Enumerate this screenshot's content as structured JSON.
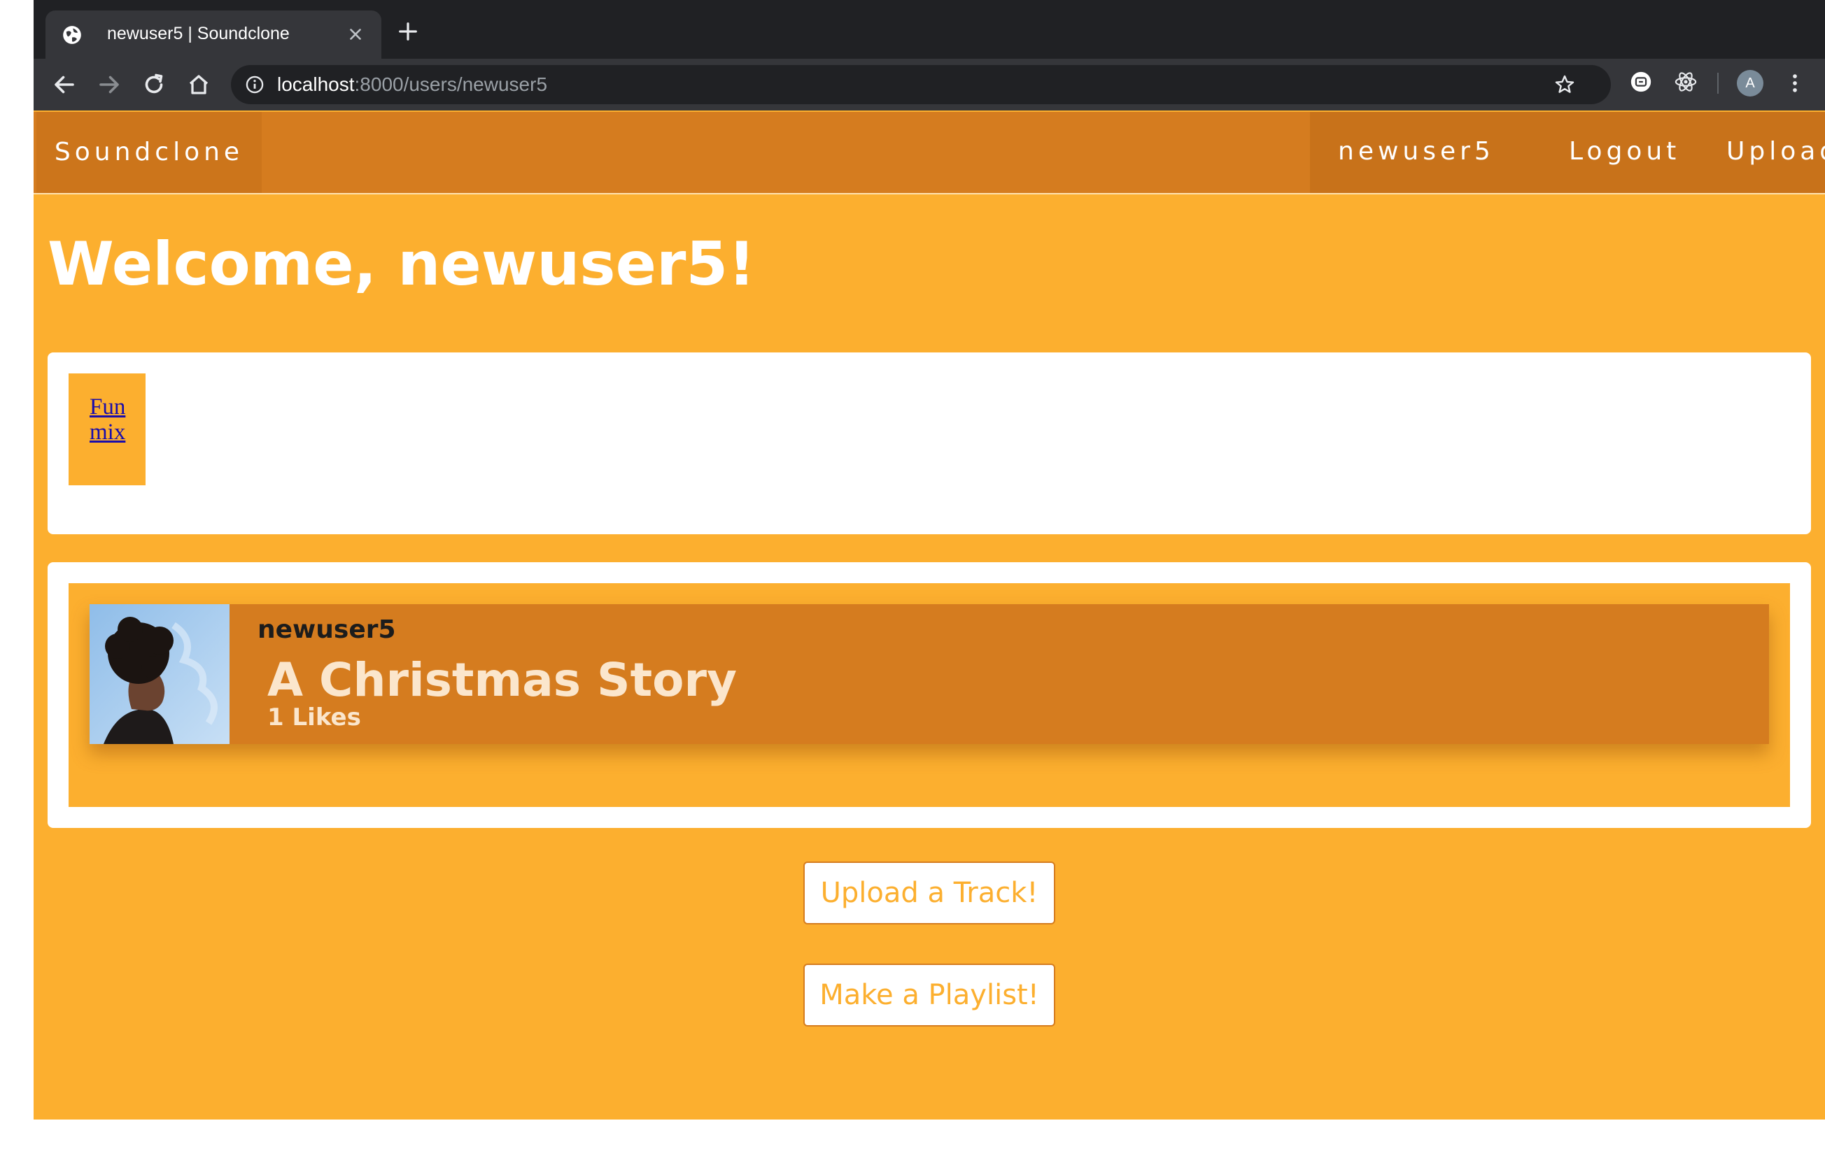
{
  "browser": {
    "tab_title": "newuser5 | Soundclone",
    "url_host": "localhost",
    "url_path": ":8000/users/newuser5",
    "profile_initial": "A"
  },
  "navbar": {
    "brand": "Soundclone",
    "username": "newuser5",
    "logout": "Logout",
    "upload": "Upload"
  },
  "welcome": "Welcome, newuser5!",
  "playlists": [
    {
      "name": "Fun mix"
    }
  ],
  "tracks": [
    {
      "artist": "newuser5",
      "title": "A Christmas Story",
      "likes": "1 Likes"
    }
  ],
  "actions": {
    "upload_track": "Upload a Track!",
    "make_playlist": "Make a Playlist!"
  },
  "colors": {
    "page_bg": "#fcaf2f",
    "navbar_bg": "#d57c1f",
    "card_bg": "#d57c1f"
  }
}
